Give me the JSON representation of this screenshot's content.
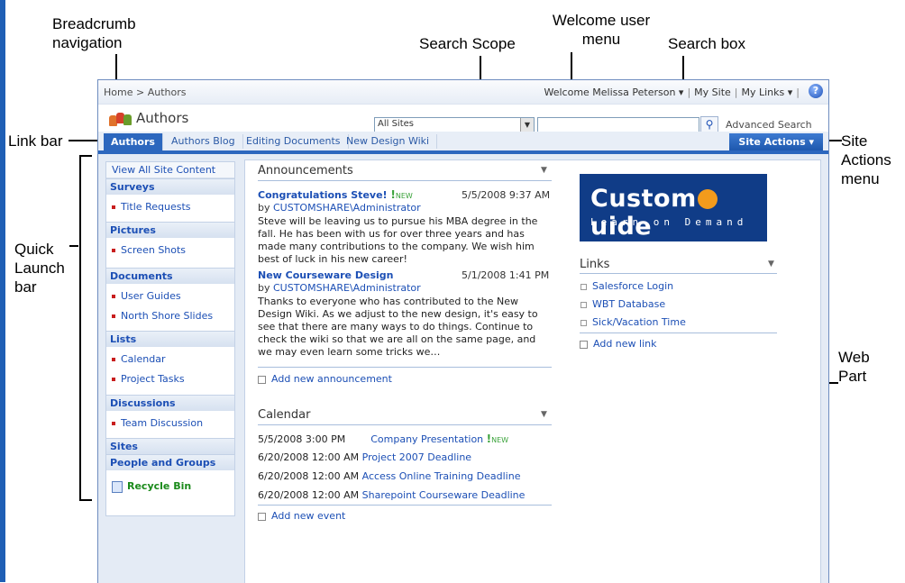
{
  "callouts": {
    "breadcrumb": "Breadcrumb navigation",
    "search_scope": "Search Scope",
    "welcome_menu": "Welcome user menu",
    "search_box": "Search box",
    "link_bar": "Link bar",
    "site_actions_menu": "Site Actions menu",
    "quick_launch": "Quick Launch bar",
    "web_part": "Web Part"
  },
  "topbar": {
    "breadcrumb": "Home > Authors",
    "welcome": "Welcome Melissa Peterson ▾",
    "my_site": "My Site",
    "my_links": "My Links ▾",
    "help_icon": "help-icon"
  },
  "site": {
    "title": "Authors",
    "search_scope": "All Sites",
    "search_placeholder": "",
    "advanced_search": "Advanced Search"
  },
  "tabs": [
    "Authors",
    "Authors Blog",
    "Editing Documents",
    "New Design Wiki"
  ],
  "site_actions": "Site Actions ▾",
  "quick_launch": {
    "view_all": "View All Site Content",
    "sections": [
      {
        "heading": "Surveys",
        "items": [
          "Title Requests"
        ]
      },
      {
        "heading": "Pictures",
        "items": [
          "Screen Shots"
        ]
      },
      {
        "heading": "Documents",
        "items": [
          "User Guides",
          "North Shore Slides"
        ]
      },
      {
        "heading": "Lists",
        "items": [
          "Calendar",
          "Project Tasks"
        ]
      },
      {
        "heading": "Discussions",
        "items": [
          "Team Discussion"
        ]
      },
      {
        "heading": "Sites",
        "items": []
      },
      {
        "heading": "People and Groups",
        "items": []
      }
    ],
    "recycle_bin": "Recycle Bin"
  },
  "announcements": {
    "title": "Announcements",
    "items": [
      {
        "title": "Congratulations Steve!",
        "new": "NEW",
        "date": "5/5/2008 9:37 AM",
        "by_prefix": "by",
        "by": "CUSTOMSHARE\\Administrator",
        "body": "Steve will be leaving us to pursue his MBA degree in the fall. He has been with us for over three years and has made many contributions to the company. We wish him best of luck in his new career!"
      },
      {
        "title": "New Courseware Design",
        "new": "",
        "date": "5/1/2008 1:41 PM",
        "by_prefix": "by",
        "by": "CUSTOMSHARE\\Administrator",
        "body": "Thanks to everyone who has contributed to the New Design Wiki. As we adjust to the new design, it's easy to see that there are many ways to do things. Continue to check the wiki so that we are all on the same page, and we may even learn some tricks we…"
      }
    ],
    "add": "Add new announcement"
  },
  "calendar": {
    "title": "Calendar",
    "events": [
      {
        "when": "5/5/2008 3:00 PM",
        "what": "Company Presentation",
        "new": "NEW"
      },
      {
        "when": "6/20/2008 12:00 AM",
        "what": "Project 2007 Deadline",
        "new": ""
      },
      {
        "when": "6/20/2008 12:00 AM",
        "what": "Access Online Training Deadline",
        "new": ""
      },
      {
        "when": "6/20/2008 12:00 AM",
        "what": "Sharepoint Courseware Deadline",
        "new": ""
      }
    ],
    "add": "Add new event"
  },
  "logo": {
    "main_left": "Custom",
    "main_right": "uide",
    "tagline": "Learn on Demand"
  },
  "links": {
    "title": "Links",
    "items": [
      "Salesforce Login",
      "WBT Database",
      "Sick/Vacation Time"
    ],
    "add": "Add new link"
  },
  "colors": {
    "accent": "#2c67be",
    "link": "#1c4fb5",
    "new_badge": "#3ba33b",
    "bullet": "#c81e1e"
  }
}
